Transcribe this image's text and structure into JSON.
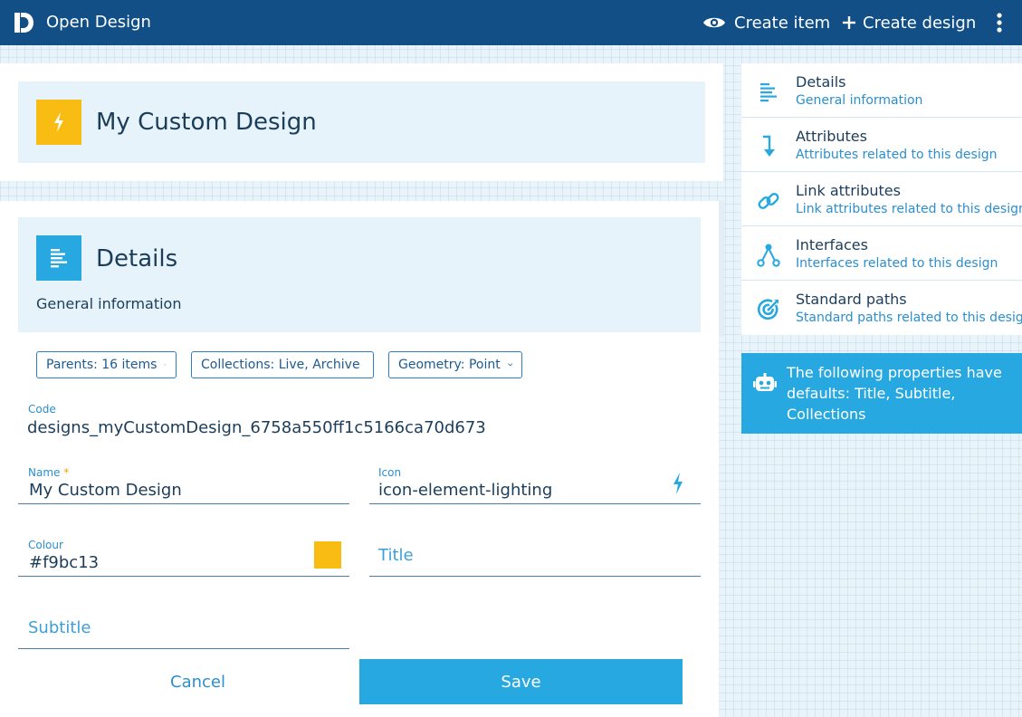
{
  "app": {
    "title": "Open Design",
    "logo_icon": "open-design-logo",
    "actions": [
      {
        "label": "Create item",
        "icon": "eye-icon"
      },
      {
        "label": "Create design",
        "icon": "plus-icon"
      }
    ],
    "menu_icon": "more-vertical-icon"
  },
  "header": {
    "title": "My Custom Design",
    "icon": "lightning-icon",
    "icon_color": "#f9bc13"
  },
  "details": {
    "title": "Details",
    "subtitle": "General information",
    "icon": "details-list-icon",
    "icon_color": "#27a8e0"
  },
  "filters": [
    {
      "label": "Parents: 16 items"
    },
    {
      "label": "Collections: Live, Archive"
    },
    {
      "label": "Geometry: Point"
    }
  ],
  "form": {
    "code": {
      "label": "Code",
      "value": "designs_myCustomDesign_6758a550ff1c5166ca70d673"
    },
    "name": {
      "label": "Name",
      "required_mark": "*",
      "value": "My Custom Design"
    },
    "icon": {
      "label": "Icon",
      "value": "icon-element-lighting"
    },
    "colour": {
      "label": "Colour",
      "value": "#f9bc13"
    },
    "title": {
      "placeholder": "Title"
    },
    "subtitle": {
      "placeholder": "Subtitle"
    },
    "cancel_label": "Cancel",
    "save_label": "Save"
  },
  "sidebar": {
    "items": [
      {
        "title": "Details",
        "subtitle": "General information",
        "icon": "details-list-icon"
      },
      {
        "title": "Attributes",
        "subtitle": "Attributes related to this design",
        "icon": "arrow-down-icon"
      },
      {
        "title": "Link attributes",
        "subtitle": "Link attributes related to this design",
        "icon": "link-icon"
      },
      {
        "title": "Interfaces",
        "subtitle": "Interfaces related to this design",
        "icon": "interfaces-icon"
      },
      {
        "title": "Standard paths",
        "subtitle": "Standard paths related to this design",
        "icon": "target-icon"
      }
    ]
  },
  "notice": {
    "icon": "robot-icon",
    "text": "The following properties have defaults: Title, Subtitle, Collections"
  },
  "colors": {
    "topbar": "#124f86",
    "accent": "#27a8e0",
    "design_colour": "#f9bc13"
  }
}
